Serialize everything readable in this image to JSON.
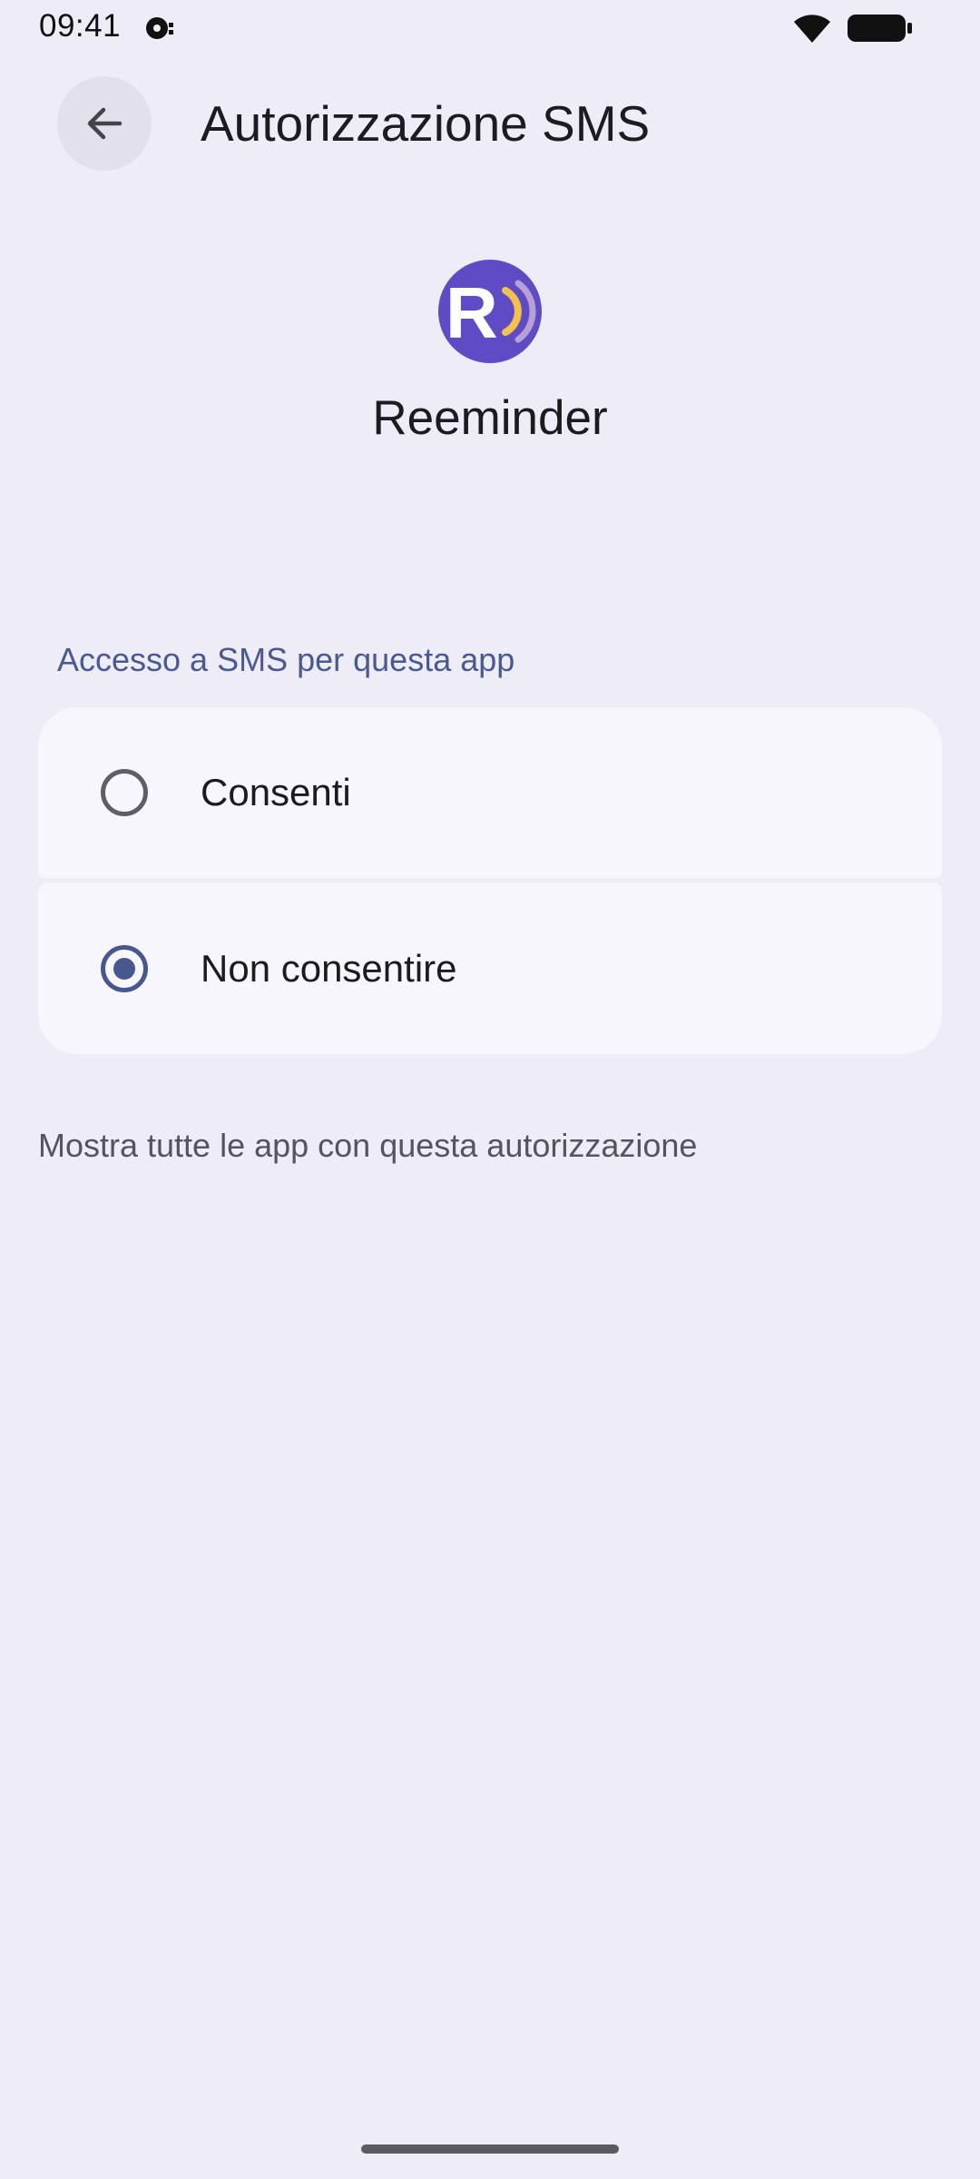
{
  "status_bar": {
    "time": "09:41",
    "icons": [
      "notification-icon",
      "wifi-icon",
      "battery-icon"
    ]
  },
  "app_bar": {
    "back_icon": "arrow-left-icon",
    "title": "Autorizzazione SMS"
  },
  "app": {
    "name": "Reeminder",
    "icon": "reeminder-app-icon",
    "icon_colors": {
      "background": "#5f4bc4",
      "letter": "#ffffff",
      "wave1": "#f2c14e",
      "wave2": "#b6a0d6"
    }
  },
  "permission": {
    "section_header": "Accesso a SMS per questa app",
    "options": [
      {
        "label": "Consenti",
        "selected": false
      },
      {
        "label": "Non consentire",
        "selected": true
      }
    ]
  },
  "footer": {
    "link_text": "Mostra tutte le app con questa autorizzazione"
  },
  "colors": {
    "background": "#eeecf6",
    "card": "#f8f6fd",
    "accent": "#48578e",
    "section_header": "#4a5a8e"
  }
}
